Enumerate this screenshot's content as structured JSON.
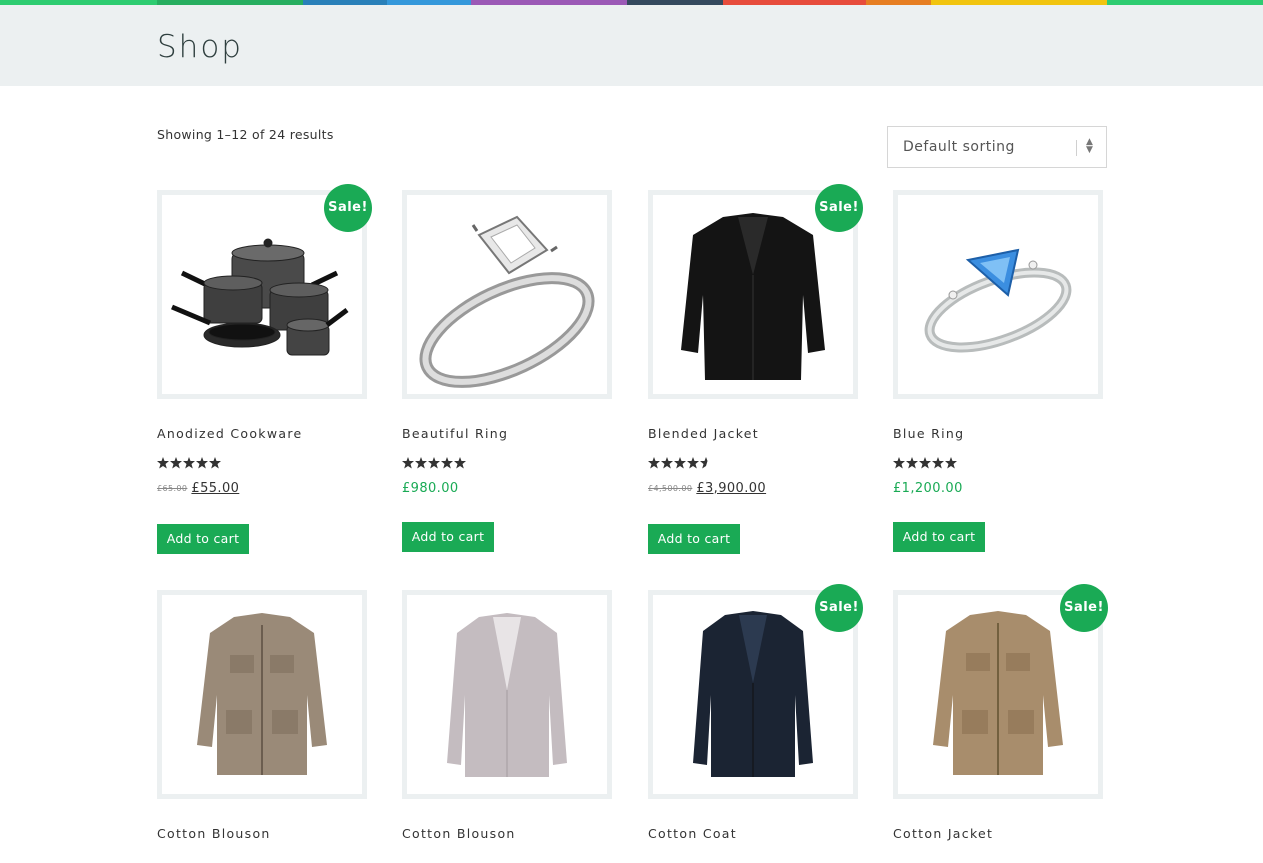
{
  "header": {
    "title": "Shop",
    "strip_colors": [
      "#2ecc71",
      "#27ae60",
      "#2980b9",
      "#3498db",
      "#9b59b6",
      "#34495e",
      "#e74c3c",
      "#e67e22",
      "#f1c40f",
      "#2ecc71"
    ]
  },
  "toolbar": {
    "result_count": "Showing 1–12 of 24 results",
    "sort_selected": "Default sorting"
  },
  "colors": {
    "accent": "#1aaa55",
    "header_bg": "#ecf0f1"
  },
  "products": [
    {
      "title": "Anodized Cookware",
      "sale_label": "Sale!",
      "on_sale": true,
      "old_price": "£65.00",
      "price": "£55.00",
      "rating": 5,
      "button": "Add to cart",
      "image": "cookware-image"
    },
    {
      "title": "Beautiful Ring",
      "on_sale": false,
      "price": "£980.00",
      "rating": 5,
      "button": "Add to cart",
      "image": "diamond-ring-image"
    },
    {
      "title": "Blended Jacket",
      "sale_label": "Sale!",
      "on_sale": true,
      "old_price": "£4,500.00",
      "price": "£3,900.00",
      "rating": 4.5,
      "button": "Add to cart",
      "image": "black-jacket-image"
    },
    {
      "title": "Blue Ring",
      "on_sale": false,
      "price": "£1,200.00",
      "rating": 5,
      "button": "Add to cart",
      "image": "blue-ring-image"
    },
    {
      "title": "Cotton Blouson",
      "on_sale": false,
      "image": "beige-jacket-image"
    },
    {
      "title": "Cotton Blouson",
      "on_sale": false,
      "image": "grey-blazer-image"
    },
    {
      "title": "Cotton Coat",
      "sale_label": "Sale!",
      "on_sale": true,
      "image": "navy-coat-image"
    },
    {
      "title": "Cotton Jacket",
      "sale_label": "Sale!",
      "on_sale": true,
      "image": "tan-jacket-image"
    }
  ]
}
